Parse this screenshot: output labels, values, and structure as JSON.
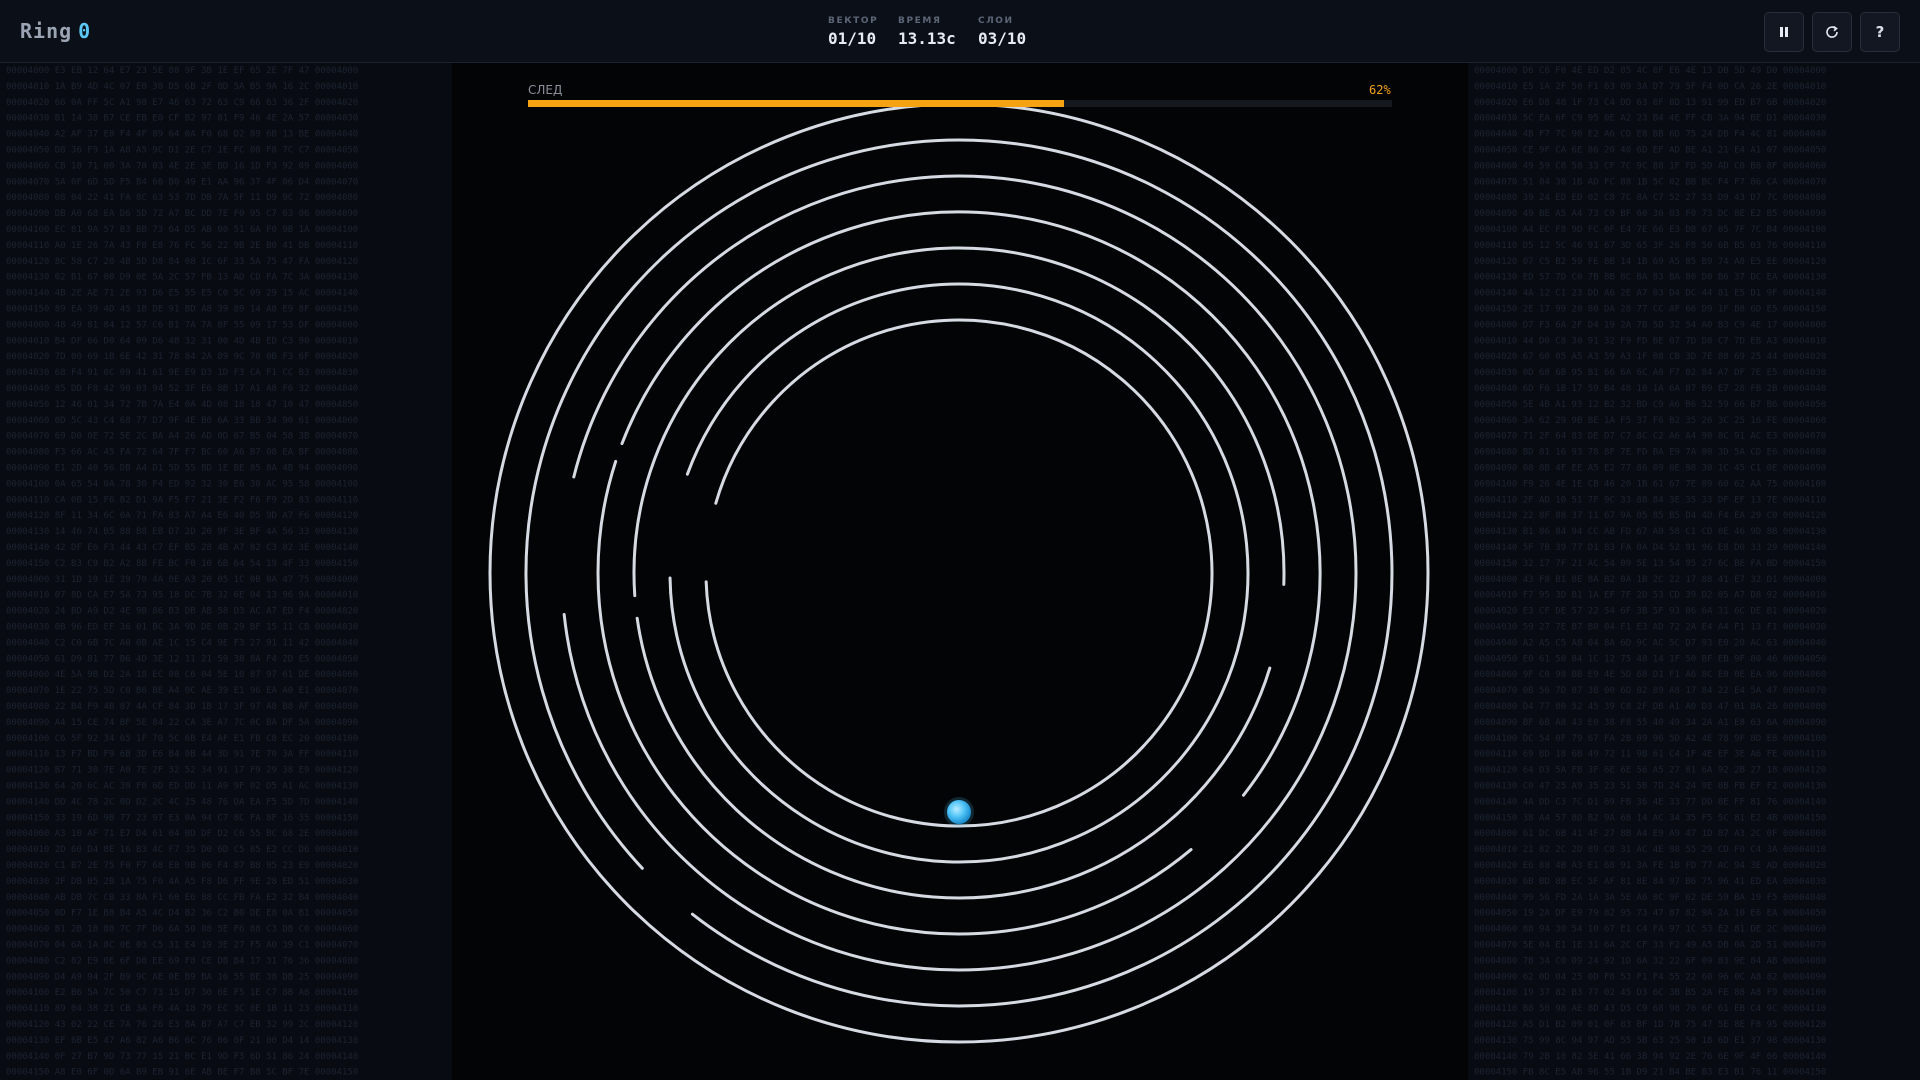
{
  "app": {
    "title": "Ring",
    "score": "0"
  },
  "stats": {
    "vector_label": "ВЕКТОР",
    "vector_value": "01/10",
    "time_label": "ВРЕМЯ",
    "time_value": "13.13с",
    "layers_label": "СЛОИ",
    "layers_value": "03/10"
  },
  "controls": {
    "pause_icon": "pause-icon",
    "restart_icon": "restart-icon",
    "help_label": "?"
  },
  "trail": {
    "label": "СЛЕД",
    "percent_text": "62%",
    "progress": 0.62
  },
  "colors": {
    "accent": "#f5a312",
    "ring": "#d6dbe3",
    "ball": "#4fc3f7",
    "score": "#5bc7f5"
  },
  "game": {
    "ring_count": 7,
    "ball_ring_index": 0,
    "ball_angle_deg": 90
  }
}
